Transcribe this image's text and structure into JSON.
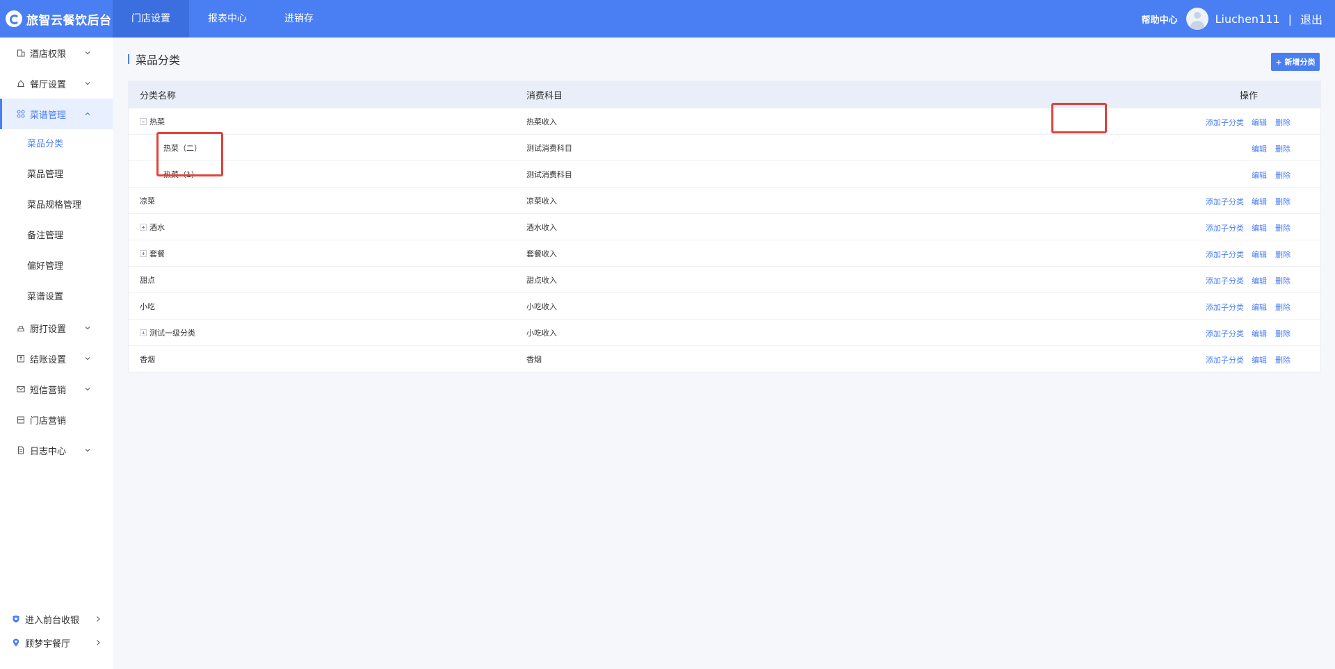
{
  "app": {
    "title": "旅智云餐饮后台"
  },
  "topnav": [
    {
      "label": "门店设置",
      "active": true
    },
    {
      "label": "报表中心",
      "active": false
    },
    {
      "label": "进销存",
      "active": false
    }
  ],
  "user": {
    "help": "帮助中心",
    "name": "Liuchen111",
    "separator": "|",
    "logout": "退出"
  },
  "sidebar": {
    "items": [
      {
        "label": "酒店权限",
        "icon": "building-icon"
      },
      {
        "label": "餐厅设置",
        "icon": "home-icon"
      },
      {
        "label": "菜谱管理",
        "icon": "grid-icon",
        "expanded": true
      },
      {
        "label": "厨打设置",
        "icon": "printer-icon"
      },
      {
        "label": "结账设置",
        "icon": "checkout-icon"
      },
      {
        "label": "短信营销",
        "icon": "mail-icon"
      },
      {
        "label": "门店营销",
        "icon": "store-icon"
      },
      {
        "label": "日志中心",
        "icon": "document-icon"
      }
    ],
    "subitems": [
      {
        "label": "菜品分类",
        "active": true
      },
      {
        "label": "菜品管理",
        "active": false
      },
      {
        "label": "菜品规格管理",
        "active": false
      },
      {
        "label": "备注管理",
        "active": false
      },
      {
        "label": "偏好管理",
        "active": false
      },
      {
        "label": "菜谱设置",
        "active": false
      }
    ],
    "bottom": [
      {
        "label": "进入前台收银",
        "icon": "cashier-icon"
      },
      {
        "label": "顾梦宇餐厅",
        "icon": "location-icon"
      }
    ]
  },
  "page": {
    "title": "菜品分类",
    "add_button": "+ 新增分类"
  },
  "table": {
    "columns": [
      "分类名称",
      "消费科目",
      "操作"
    ],
    "actions": {
      "add_child": "添加子分类",
      "edit": "编辑",
      "delete": "删除"
    },
    "rows": [
      {
        "name": "热菜",
        "account": "热菜收入",
        "expander": "minus",
        "level": 0,
        "can_add_child": true
      },
      {
        "name": "热菜（二）",
        "account": "测试消费科目",
        "expander": "none",
        "level": 1,
        "can_add_child": false
      },
      {
        "name": "热菜（1）",
        "account": "测试消费科目",
        "expander": "none",
        "level": 1,
        "can_add_child": false
      },
      {
        "name": "凉菜",
        "account": "凉菜收入",
        "expander": "none",
        "level": 0,
        "can_add_child": true
      },
      {
        "name": "酒水",
        "account": "酒水收入",
        "expander": "plus",
        "level": 0,
        "can_add_child": true
      },
      {
        "name": "套餐",
        "account": "套餐收入",
        "expander": "plus",
        "level": 0,
        "can_add_child": true
      },
      {
        "name": "甜点",
        "account": "甜点收入",
        "expander": "none",
        "level": 0,
        "can_add_child": true
      },
      {
        "name": "小吃",
        "account": "小吃收入",
        "expander": "none",
        "level": 0,
        "can_add_child": true
      },
      {
        "name": "测试一级分类",
        "account": "小吃收入",
        "expander": "plus",
        "level": 0,
        "can_add_child": true
      },
      {
        "name": "香烟",
        "account": "香烟",
        "expander": "none",
        "level": 0,
        "can_add_child": true
      }
    ]
  },
  "colors": {
    "primary": "#4a7ef3",
    "highlight": "#e0433b",
    "header_bg": "#e9eef8"
  }
}
